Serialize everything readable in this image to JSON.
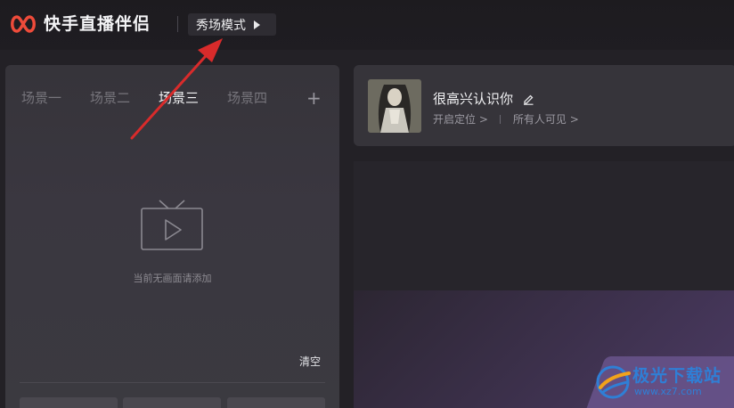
{
  "header": {
    "app_name": "快手直播伴侣",
    "mode_button_label": "秀场模式",
    "logo_icon": "kuaishou-logo-icon"
  },
  "scenes": {
    "tabs": [
      {
        "label": "场景一",
        "active": false
      },
      {
        "label": "场景二",
        "active": false
      },
      {
        "label": "场景三",
        "active": true
      },
      {
        "label": "场景四",
        "active": false
      }
    ],
    "add_label": "+",
    "empty_icon": "tv-play-icon",
    "empty_text": "当前无画面请添加",
    "clear_label": "清空"
  },
  "profile": {
    "name": "很高兴认识你",
    "edit_icon": "pencil-icon",
    "location_link": "开启定位 >",
    "visibility_link": "所有人可见 >"
  },
  "watermark": {
    "title": "极光下载站",
    "url": "www.xz7.com"
  },
  "colors": {
    "accent_red": "#e03a3a",
    "annotation_arrow": "#d92b2b",
    "watermark_blue": "#2f7fd6",
    "background": "#232126"
  }
}
